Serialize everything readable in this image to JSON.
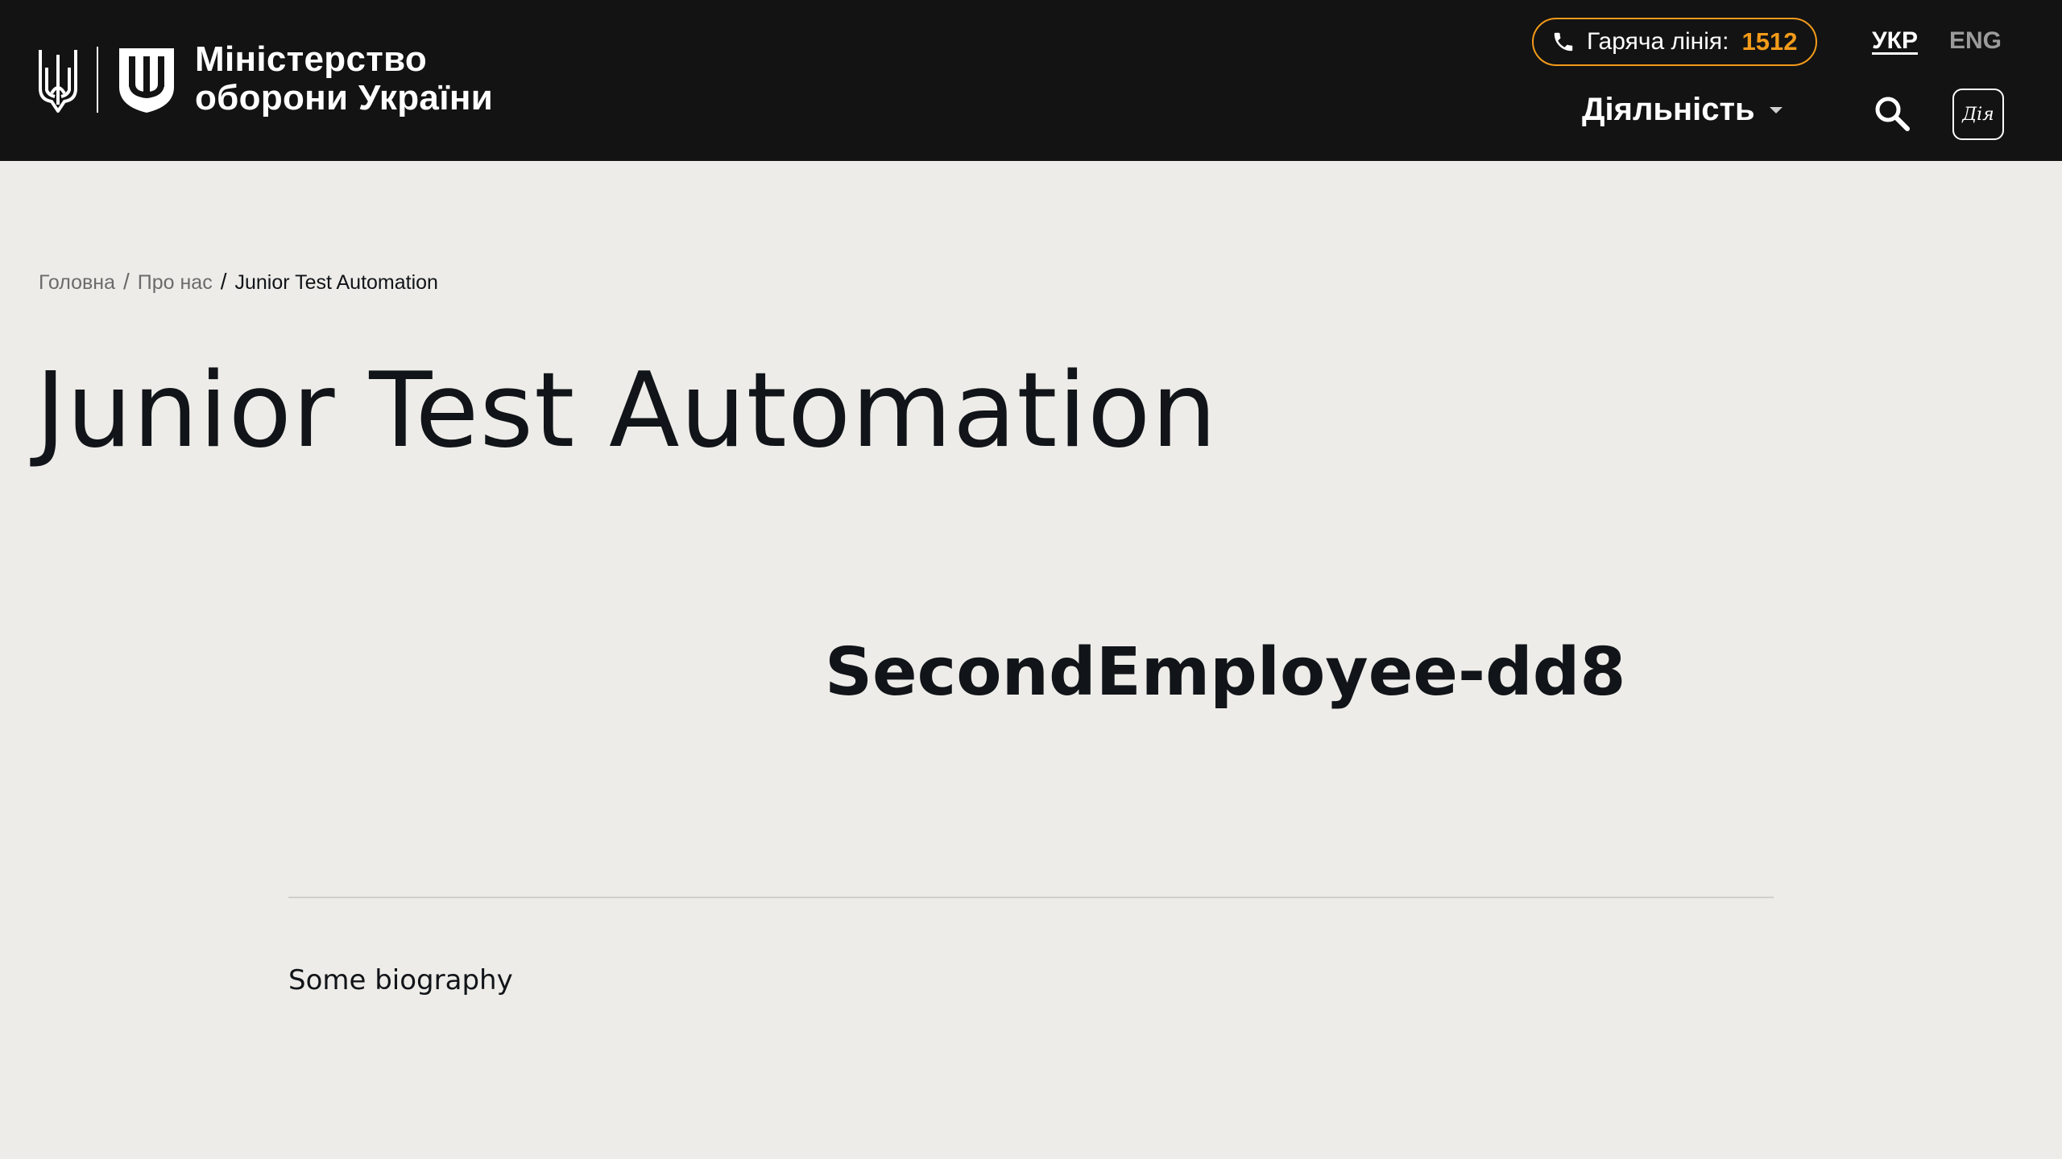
{
  "header": {
    "ministry_name_line1": "Міністерство",
    "ministry_name_line2": "оборони України",
    "hotline_label": "Гаряча лінія:",
    "hotline_number": "1512",
    "lang_ukr": "УКР",
    "lang_eng": "ENG",
    "nav_activity": "Діяльність",
    "diia_label": "Дія",
    "accent_color": "#f39b1a",
    "background_color": "#131313"
  },
  "breadcrumb": {
    "items": [
      "Головна",
      "Про нас"
    ],
    "current": "Junior Test Automation"
  },
  "main": {
    "title": "Junior Test Automation",
    "employee_name": "SecondEmployee-dd8",
    "biography": "Some biography",
    "background_color": "#edece8"
  }
}
